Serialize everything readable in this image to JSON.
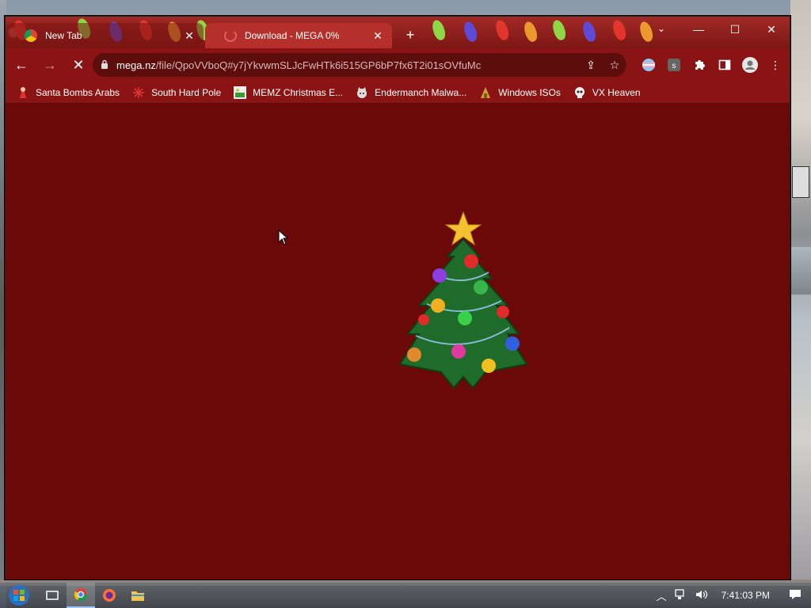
{
  "browser": {
    "tabs": [
      {
        "label": "New Tab",
        "close": "✕"
      },
      {
        "label": "Download - MEGA 0%",
        "close": "✕"
      }
    ],
    "new_tab": "+",
    "tab_search": "⌄",
    "window_controls": {
      "minimize": "—",
      "maximize": "☐",
      "close": "✕"
    }
  },
  "toolbar": {
    "back": "←",
    "forward": "→",
    "reload": "✕",
    "url_host": "mega.nz",
    "url_path": "/file/QpoVVboQ#y7jYkvwmSLJcFwHTk6i515GP6bP7fx6T2i01sOVfuMc",
    "share": "⇪",
    "star": "☆",
    "menu": "⋮"
  },
  "bookmarks": [
    {
      "label": "Santa Bombs Arabs",
      "icon": "santa-icon"
    },
    {
      "label": "South Hard Pole",
      "icon": "snowflake-icon"
    },
    {
      "label": "MEMZ Christmas E...",
      "icon": "image-icon"
    },
    {
      "label": "Endermanch Malwa...",
      "icon": "cat-icon"
    },
    {
      "label": "Windows ISOs",
      "icon": "folder-icon"
    },
    {
      "label": "VX Heaven",
      "icon": "skull-icon"
    }
  ],
  "taskbar": {
    "clock": "7:41:03 PM"
  },
  "colors": {
    "page_bg": "#6b0808",
    "toolbar_bg": "#8a1414",
    "tab_active": "#b5302b"
  }
}
